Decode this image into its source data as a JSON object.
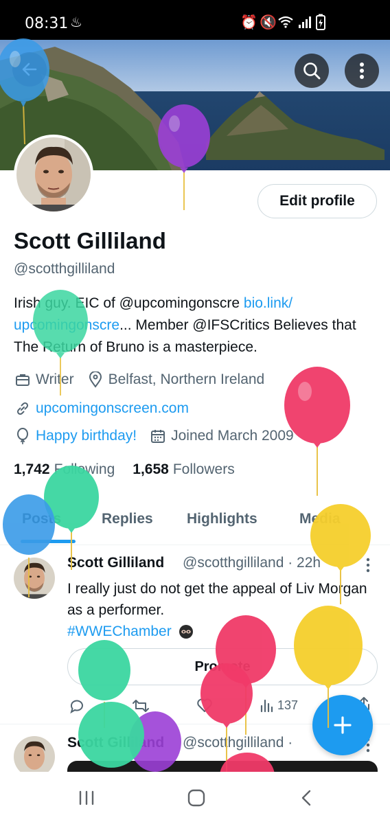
{
  "status_bar": {
    "time": "08:31"
  },
  "header": {
    "back_icon": "arrow-left-icon",
    "search_icon": "search-icon",
    "more_icon": "more-vertical-icon"
  },
  "profile": {
    "name": "Scott Gilliland",
    "handle": "@scotthgilliland",
    "edit_label": "Edit profile",
    "bio": {
      "part1": "Irish guy. EIC of @upcomingonscre ",
      "link1": "bio.link/",
      "link2": "upcomingonscre",
      "part2": "... Member @IFSCritics Believes that The Return of Bruno is a masterpiece."
    },
    "occupation": "Writer",
    "location": "Belfast, Northern Ireland",
    "website": "upcomingonscreen.com",
    "birthday": "Happy birthday!",
    "joined": "Joined March 2009",
    "following_count": "1,742",
    "following_label": "Following",
    "followers_count": "1,658",
    "followers_label": "Followers"
  },
  "tabs": [
    "Posts",
    "Replies",
    "Highlights",
    "Media"
  ],
  "tweets": [
    {
      "name": "Scott Gilliland",
      "handle": "@scotthgilliland · 22h",
      "text": "I really just do not get the appeal of Liv Morgan as a performer.",
      "hashtag": "#WWEChamber",
      "promote_label": "Promote",
      "views": "137"
    },
    {
      "name": "Scott Gilliland",
      "handle": "@scotthgilliland ·"
    }
  ],
  "colors": {
    "accent": "#1d9bf0",
    "text_primary": "#0f1419",
    "text_secondary": "#536471"
  }
}
